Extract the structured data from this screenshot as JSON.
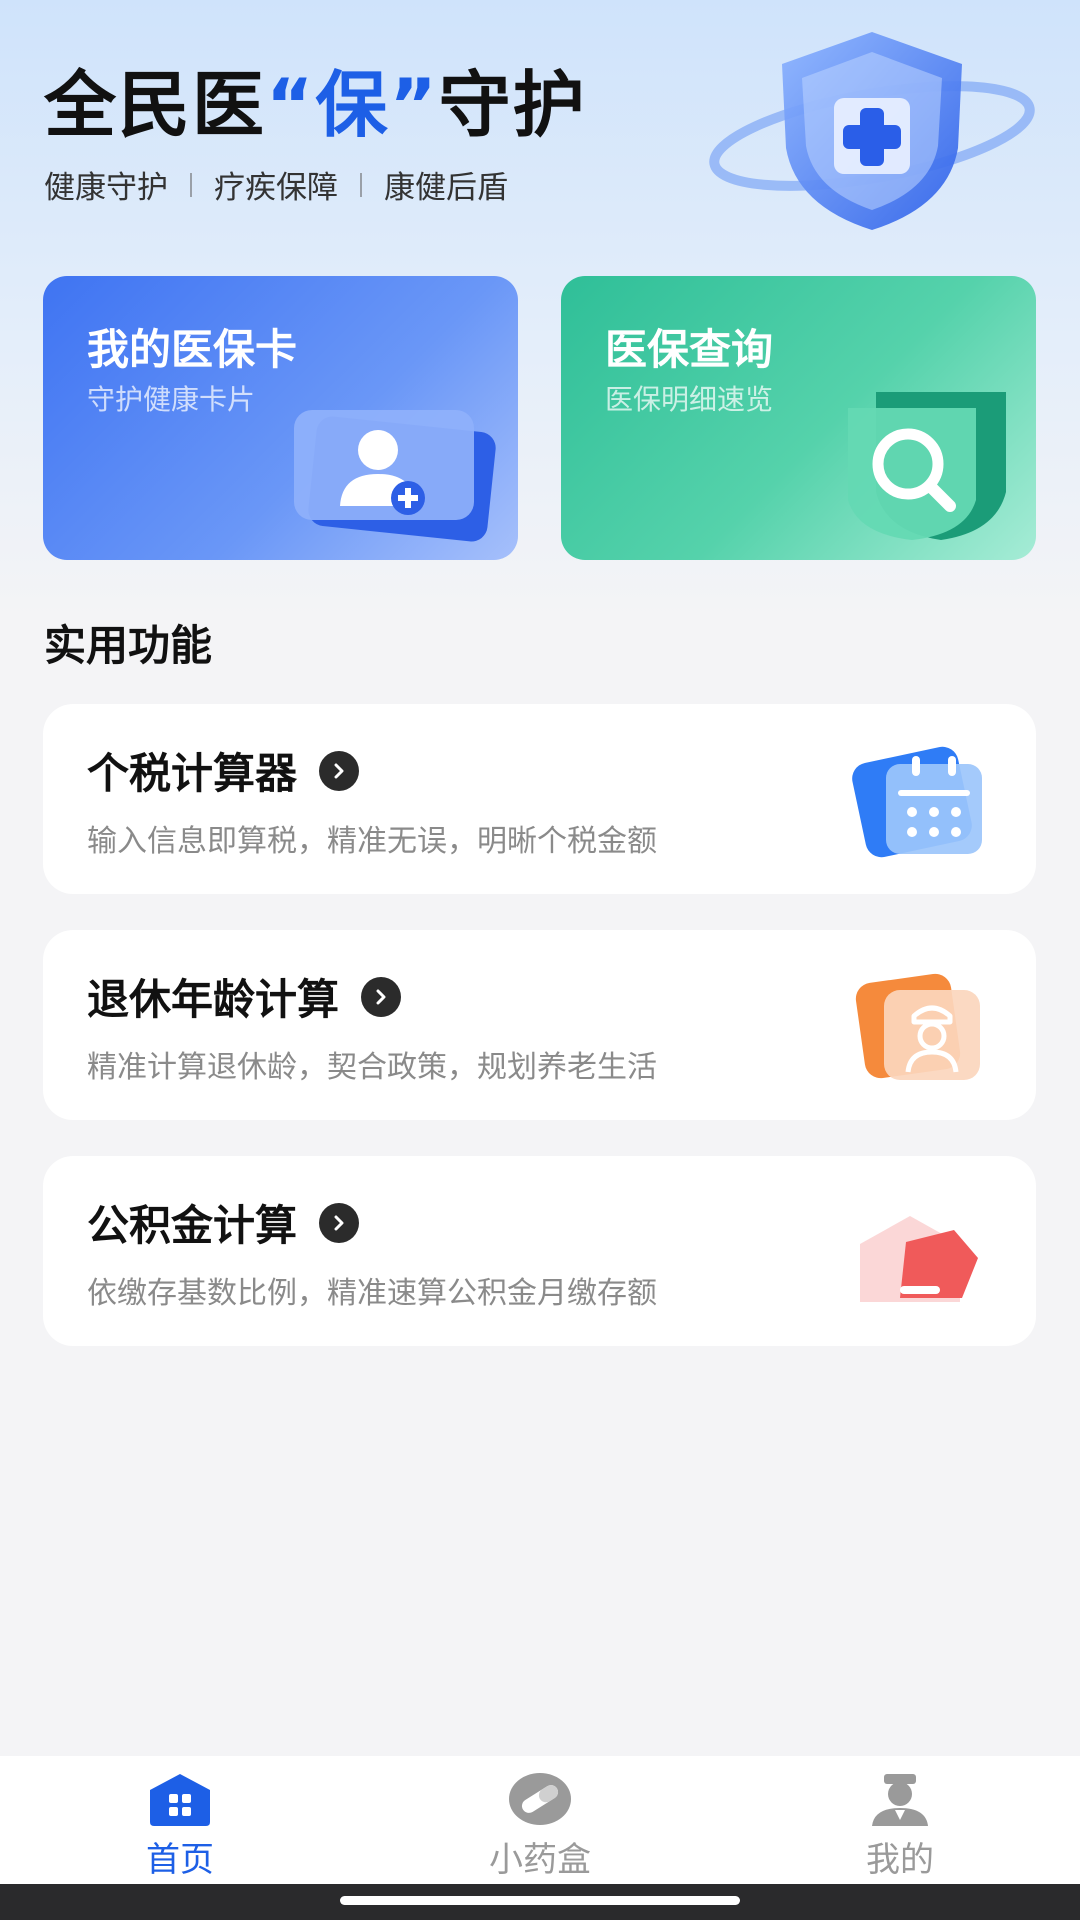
{
  "hero": {
    "title_part1": "全民医",
    "title_accent": "“保”",
    "title_part2": "守护",
    "tags": [
      "健康守护",
      "疗疾保障",
      "康健后盾"
    ]
  },
  "cards": [
    {
      "title": "我的医保卡",
      "subtitle": "守护健康卡片",
      "icon": "user-plus-card-icon"
    },
    {
      "title": "医保查询",
      "subtitle": "医保明细速览",
      "icon": "shield-search-icon"
    }
  ],
  "section": {
    "title": "实用功能"
  },
  "functions": [
    {
      "title": "个税计算器",
      "desc": "输入信息即算税，精准无误，明晰个税金额",
      "icon": "calendar-calculator-icon"
    },
    {
      "title": "退休年龄计算",
      "desc": "精准计算退休龄，契合政策，规划养老生活",
      "icon": "retiree-icon"
    },
    {
      "title": "公积金计算",
      "desc": "依缴存基数比例，精准速算公积金月缴存额",
      "icon": "house-fund-icon"
    }
  ],
  "tabbar": {
    "items": [
      {
        "label": "首页",
        "icon": "home-icon",
        "active": true
      },
      {
        "label": "小药盒",
        "icon": "pill-icon",
        "active": false
      },
      {
        "label": "我的",
        "icon": "profile-icon",
        "active": false
      }
    ]
  },
  "colors": {
    "accent": "#1d5fe6",
    "insurance_card": "#3f74f2",
    "query_card": "#2fbf98",
    "tab_inactive": "#9a9a9a"
  }
}
